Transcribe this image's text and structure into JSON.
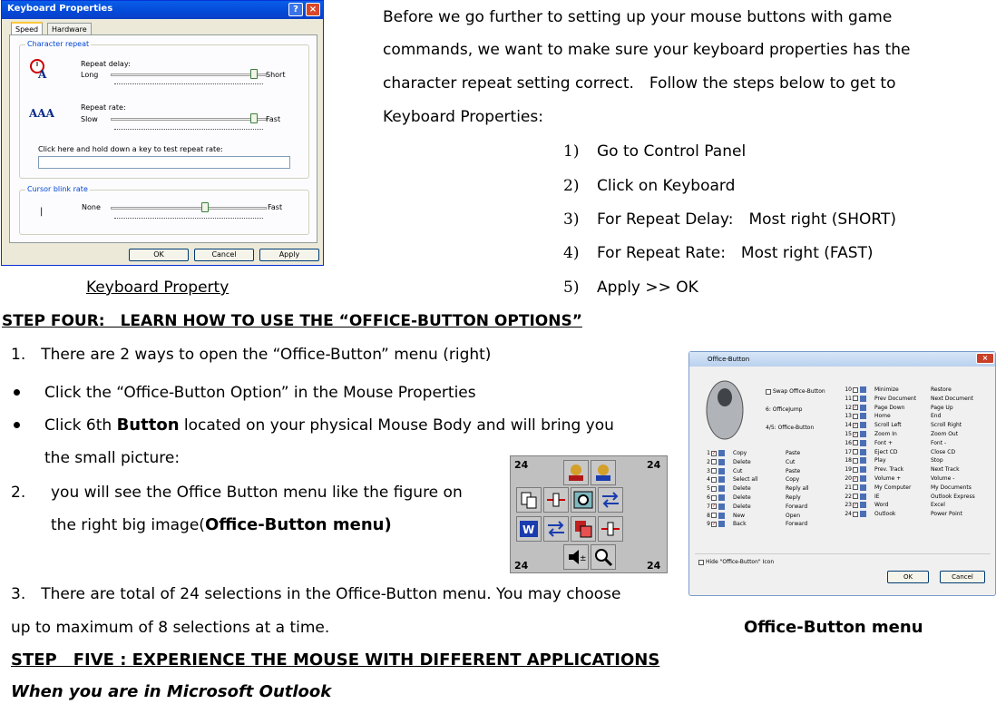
{
  "keyboard_dialog": {
    "title": "Keyboard Properties",
    "tabs": [
      "Speed",
      "Hardware"
    ],
    "character_repeat_group": "Character repeat",
    "repeat_delay_label": "Repeat delay:",
    "repeat_delay_min": "Long",
    "repeat_delay_max": "Short",
    "repeat_rate_label": "Repeat rate:",
    "repeat_rate_min": "Slow",
    "repeat_rate_max": "Fast",
    "test_label": "Click here and hold down a key to test repeat rate:",
    "cursor_group": "Cursor blink rate",
    "cursor_min": "None",
    "cursor_max": "Fast",
    "buttons": [
      "OK",
      "Cancel",
      "Apply"
    ],
    "caption": "Keyboard Property"
  },
  "intro": {
    "lines": [
      "Before we go further to setting up your mouse buttons with game",
      "commands, we want to make sure your keyboard properties has the",
      "character repeat setting correct.　Follow the steps below to get to",
      "Keyboard Properties:"
    ],
    "steps": [
      {
        "num": "1)",
        "text": "Go to Control Panel"
      },
      {
        "num": "2)",
        "text": "Click on Keyboard"
      },
      {
        "num": "3)",
        "text": "For Repeat Delay:　Most right (SHORT)"
      },
      {
        "num": "4)",
        "text": "For Repeat Rate:　Most right (FAST)"
      },
      {
        "num": "5)",
        "text": "Apply >> OK"
      }
    ]
  },
  "step_four": {
    "heading": "STEP FOUR:　LEARN HOW TO USE THE “OFFICE-BUTTON OPTIONS”",
    "item1": "1.　There are 2 ways to open the “Office-Button” menu (right)",
    "bullet1": "Click the “Office-Button Option” in the Mouse Properties",
    "bullet2_pre": "Click 6th ",
    "bullet2_bold": "Button",
    "bullet2_post": " located on your physical Mouse Body and will bring you",
    "bullet2_cont": "the small picture:",
    "item2_num": "2.",
    "item2_line1": "you will see the Office Button menu like the figure on",
    "item2_line2_pre": "the right big image(",
    "item2_line2_bold": "Office-Button menu)",
    "item3_line1": "3.　There are total of 24 selections in the Office-Button menu. You may choose",
    "item3_line2": "up to maximum of 8 selections at a time.",
    "office_caption": "Office-Button menu"
  },
  "step_five": {
    "heading": "STEP　FIVE : EXPERIENCE THE MOUSE WITH DIFFERENT APPLICATIONS",
    "subheading": "When you are in Microsoft Outlook"
  },
  "office_dialog": {
    "title": "Office-Button",
    "swap_label": "Swap Office-Button",
    "officejump": "6: OfficeJump",
    "officebutton": "4/5: Office-Button",
    "hide_label": "Hide \"Office-Button\" Icon",
    "ok": "OK",
    "cancel": "Cancel",
    "left_rows": [
      {
        "n": "1",
        "checked": true,
        "name": "Copy",
        "alt": "Paste"
      },
      {
        "n": "2",
        "checked": false,
        "name": "Delete",
        "alt": "Cut"
      },
      {
        "n": "3",
        "checked": false,
        "name": "Cut",
        "alt": "Paste"
      },
      {
        "n": "4",
        "checked": false,
        "name": "Select all",
        "alt": "Copy"
      },
      {
        "n": "5",
        "checked": false,
        "name": "Delete",
        "alt": "Reply all"
      },
      {
        "n": "6",
        "checked": false,
        "name": "Delete",
        "alt": "Reply"
      },
      {
        "n": "7",
        "checked": true,
        "name": "Delete",
        "alt": "Forward"
      },
      {
        "n": "8",
        "checked": false,
        "name": "New",
        "alt": "Open"
      },
      {
        "n": "9",
        "checked": true,
        "name": "Back",
        "alt": "Forward"
      }
    ],
    "right_rows": [
      {
        "n": "10",
        "checked": false,
        "name": "Minimize",
        "alt": "Restore"
      },
      {
        "n": "11",
        "checked": false,
        "name": "Prev Document",
        "alt": "Next Document"
      },
      {
        "n": "12",
        "checked": true,
        "name": "Page Down",
        "alt": "Page Up"
      },
      {
        "n": "13",
        "checked": false,
        "name": "Home",
        "alt": "End"
      },
      {
        "n": "14",
        "checked": true,
        "name": "Scroll Left",
        "alt": "Scroll Right"
      },
      {
        "n": "15",
        "checked": true,
        "name": "Zoom In",
        "alt": "Zoom Out"
      },
      {
        "n": "16",
        "checked": false,
        "name": "Font +",
        "alt": "Font -"
      },
      {
        "n": "17",
        "checked": false,
        "name": "Eject CD",
        "alt": "Close CD"
      },
      {
        "n": "18",
        "checked": false,
        "name": "Play",
        "alt": "Stop"
      },
      {
        "n": "19",
        "checked": false,
        "name": "Prev. Track",
        "alt": "Next Track"
      },
      {
        "n": "20",
        "checked": true,
        "name": "Volume +",
        "alt": "Volume -"
      },
      {
        "n": "21",
        "checked": false,
        "name": "My Computer",
        "alt": "My Documents"
      },
      {
        "n": "22",
        "checked": false,
        "name": "IE",
        "alt": "Outlook Express"
      },
      {
        "n": "23",
        "checked": true,
        "name": "Word",
        "alt": "Excel"
      },
      {
        "n": "24",
        "checked": false,
        "name": "Outlook",
        "alt": "Power Point"
      }
    ]
  },
  "menu_grid": {
    "corner_number": "24"
  }
}
